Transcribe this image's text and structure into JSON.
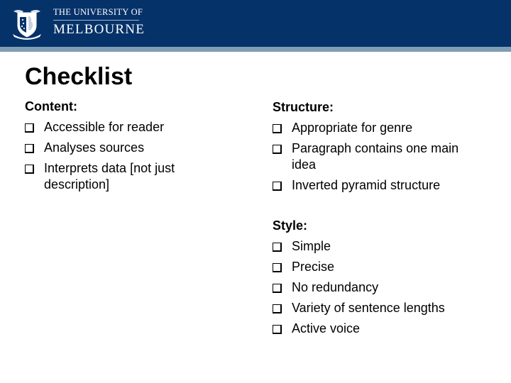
{
  "header": {
    "logo_line1": "THE UNIVERSITY OF",
    "logo_line2": "MELBOURNE",
    "brand_color": "#06326a",
    "stripe_color": "#7f9eb5"
  },
  "slide": {
    "title": "Checklist"
  },
  "sections": {
    "content": {
      "heading": "Content:",
      "items": [
        {
          "label": "Accessible for reader",
          "checked": false
        },
        {
          "label": "Analyses sources",
          "checked": false
        },
        {
          "label": "Interprets data [not just description]",
          "checked": false
        }
      ]
    },
    "structure": {
      "heading": "Structure:",
      "items": [
        {
          "label": "Appropriate for genre",
          "checked": false
        },
        {
          "label": "Paragraph contains one main idea",
          "checked": false
        },
        {
          "label": "Inverted pyramid structure",
          "checked": false
        }
      ]
    },
    "style": {
      "heading": "Style:",
      "items": [
        {
          "label": "Simple",
          "checked": false
        },
        {
          "label": "Precise",
          "checked": false
        },
        {
          "label": "No redundancy",
          "checked": false
        },
        {
          "label": "Variety of sentence lengths",
          "checked": false
        },
        {
          "label": "Active voice",
          "checked": false
        }
      ]
    }
  },
  "icons": {
    "crest": "university-crest-icon",
    "checkbox": "empty-checkbox-icon"
  }
}
